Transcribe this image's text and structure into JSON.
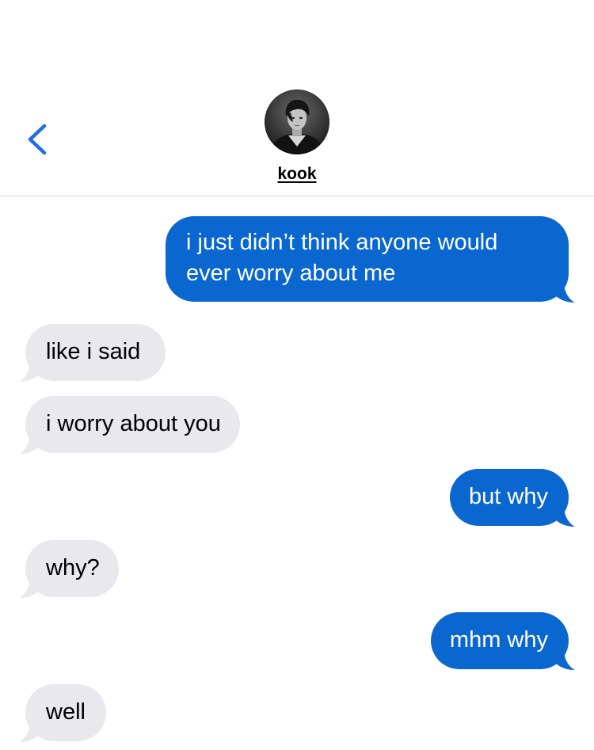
{
  "header": {
    "back_icon": "chevron-left-icon",
    "contact_name": "kook",
    "avatar": "contact-photo"
  },
  "colors": {
    "accent": "#0b67d0",
    "outgoing_bubble": "#0b67d0",
    "incoming_bubble": "#e8e8ed",
    "back_chevron": "#1f6fe0"
  },
  "messages": [
    {
      "from": "me",
      "text": "i just didn’t think anyone would\never worry about me"
    },
    {
      "from": "them",
      "text": "like i said"
    },
    {
      "from": "them",
      "text": "i worry about you"
    },
    {
      "from": "me",
      "text": "but why"
    },
    {
      "from": "them",
      "text": "why?"
    },
    {
      "from": "me",
      "text": "mhm why"
    },
    {
      "from": "them",
      "text": "well"
    }
  ]
}
